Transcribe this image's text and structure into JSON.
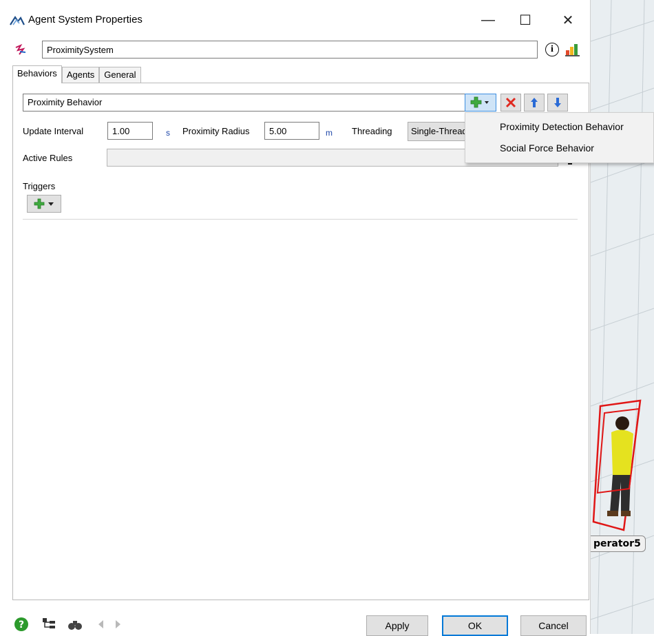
{
  "window": {
    "title": "Agent System Properties",
    "minimize": "—",
    "maximize": "☐",
    "close": "✕"
  },
  "object": {
    "name": "ProximitySystem",
    "info_glyph": "i"
  },
  "tabs": [
    {
      "label": "Behaviors",
      "active": true
    },
    {
      "label": "Agents",
      "active": false
    },
    {
      "label": "General",
      "active": false
    }
  ],
  "behaviors": {
    "selected": "Proximity Behavior",
    "update_interval_label": "Update Interval",
    "update_interval_value": "1.00",
    "update_interval_unit": "s",
    "proximity_radius_label": "Proximity Radius",
    "proximity_radius_value": "5.00",
    "proximity_radius_unit": "m",
    "threading_label": "Threading",
    "threading_value": "Single-Threaded",
    "active_rules_label": "Active Rules",
    "triggers_label": "Triggers"
  },
  "add_menu": {
    "items": [
      "Proximity Detection Behavior",
      "Social Force Behavior"
    ]
  },
  "viewport": {
    "operator_label": "perator5"
  },
  "footer": {
    "apply": "Apply",
    "ok": "OK",
    "cancel": "Cancel"
  },
  "colors": {
    "accent": "#0078d7",
    "add_green": "#3faa3f",
    "delete_red": "#e0291f",
    "arrow_blue": "#2a6bd6"
  }
}
